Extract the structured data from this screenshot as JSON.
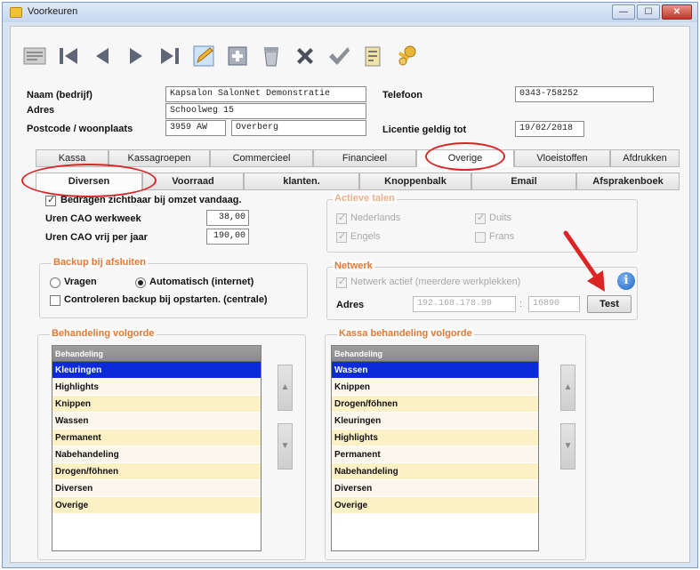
{
  "window": {
    "title": "Voorkeuren",
    "minimize_glyph": "—",
    "maximize_glyph": "☐",
    "close_glyph": "✕"
  },
  "toolbar": {
    "icons": [
      "list-icon",
      "first-record-icon",
      "previous-record-icon",
      "next-record-icon",
      "last-record-icon",
      "edit-icon",
      "new-record-icon",
      "delete-icon",
      "cancel-icon",
      "confirm-icon",
      "calendar-icon",
      "keys-icon"
    ]
  },
  "form": {
    "name_label": "Naam (bedrijf)",
    "name_value": "Kapsalon SalonNet Demonstratie",
    "address_label": "Adres",
    "address_value": "Schoolweg 15",
    "postcode_label": "Postcode / woonplaats",
    "postcode_value": "3959 AW",
    "city_value": "Overberg",
    "phone_label": "Telefoon",
    "phone_value": "0343-758252",
    "license_label": "Licentie geldig tot",
    "license_value": "19/02/2018"
  },
  "tabs_top": [
    "Kassa",
    "Kassagroepen",
    "Commercieel",
    "Financieel",
    "Overige",
    "Vloeistoffen",
    "Afdrukken"
  ],
  "tabs_sub": [
    "Diversen",
    "Voorraad",
    "klanten.",
    "Knoppenbalk",
    "Email",
    "Afsprakenboek"
  ],
  "diversen": {
    "amounts_visible_label": "Bedragen zichtbaar bij omzet vandaag.",
    "hours_week_label": "Uren CAO werkweek",
    "hours_week_value": "38,00",
    "hours_year_label": "Uren CAO vrij per jaar",
    "hours_year_value": "190,00"
  },
  "languages": {
    "title": "Actieve talen",
    "dutch": "Nederlands",
    "german": "Duits",
    "english": "Engels",
    "french": "Frans"
  },
  "backup": {
    "title": "Backup bij afsluiten",
    "ask_label": "Vragen",
    "auto_label": "Automatisch (internet)",
    "check_label": "Controleren backup bij opstarten. (centrale)"
  },
  "network": {
    "title": "Netwerk",
    "active_label": "Netwerk actief (meerdere werkplekken)",
    "address_label": "Adres",
    "ip_value": "192.168.178.99",
    "colon": ":",
    "port_value": "16890",
    "test_label": "Test",
    "info_glyph": "i"
  },
  "treatment_order": {
    "title": "Behandeling volgorde",
    "header": "Behandeling",
    "rows": [
      "Kleuringen",
      "Highlights",
      "Knippen",
      "Wassen",
      "Permanent",
      "Nabehandeling",
      "Drogen/föhnen",
      "Diversen",
      "Overige"
    ],
    "up_glyph": "▲",
    "down_glyph": "▼"
  },
  "kassa_order": {
    "title": "Kassa behandeling volgorde",
    "header": "Behandeling",
    "rows": [
      "Wassen",
      "Knippen",
      "Drogen/föhnen",
      "Kleuringen",
      "Highlights",
      "Permanent",
      "Nabehandeling",
      "Diversen",
      "Overige"
    ],
    "up_glyph": "▲",
    "down_glyph": "▼"
  },
  "colors": {
    "selected_row": "#0b2bd8",
    "group_title": "#e07a38",
    "annotation": "#dd2424",
    "row_fill": "#fcf0c5"
  }
}
